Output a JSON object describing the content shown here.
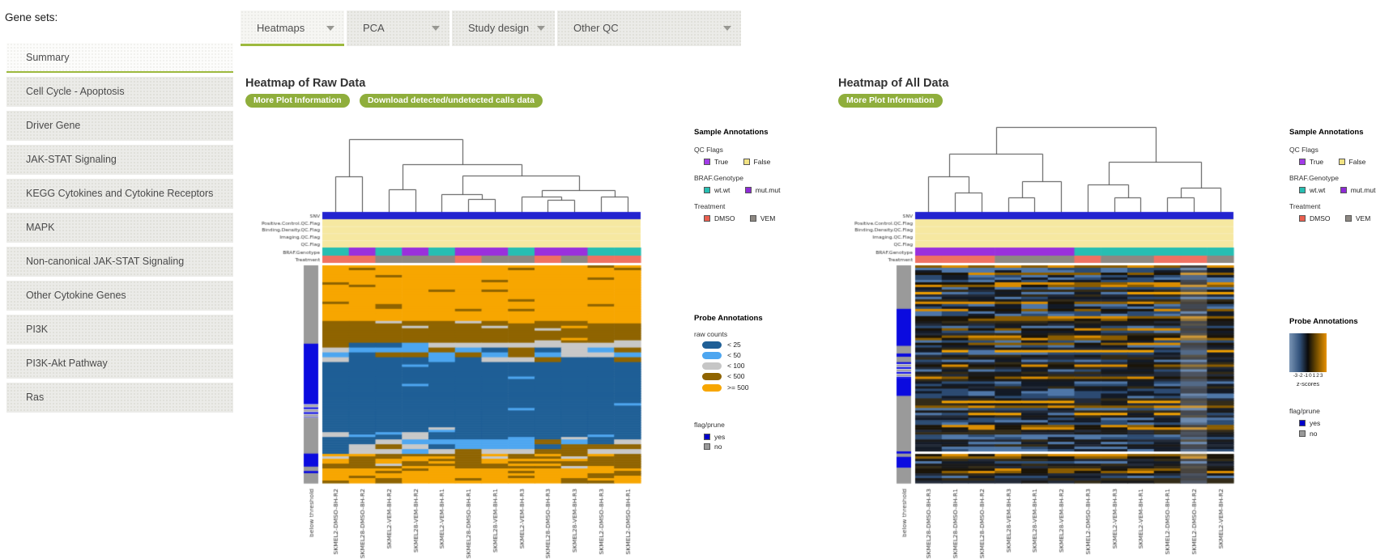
{
  "sidebar": {
    "label": "Gene sets:",
    "active_index": 0,
    "items": [
      "Summary",
      "Cell Cycle - Apoptosis",
      "Driver Gene",
      "JAK-STAT Signaling",
      "KEGG Cytokines and Cytokine Receptors",
      "MAPK",
      "Non-canonical JAK-STAT Signaling",
      "Other Cytokine Genes",
      "PI3K",
      "PI3K-Akt Pathway",
      "Ras"
    ]
  },
  "tabs": [
    "Heatmaps",
    "PCA",
    "Study design",
    "Other QC"
  ],
  "panels": {
    "raw": {
      "title": "Heatmap of Raw Data",
      "buttons": [
        "More Plot Information",
        "Download detected/undetected calls data"
      ]
    },
    "all": {
      "title": "Heatmap of All Data",
      "buttons": [
        "More Plot Information"
      ]
    }
  },
  "legend": {
    "sample_title": "Sample Annotations",
    "qc": {
      "label": "QC Flags",
      "items": [
        {
          "label": "True",
          "color": "#A23BE8"
        },
        {
          "label": "False",
          "color": "#F2E383"
        }
      ]
    },
    "braf": {
      "label": "BRAF.Genotype",
      "items": [
        {
          "label": "wt.wt",
          "color": "#27BEB2"
        },
        {
          "label": "mut.mut",
          "color": "#8E2BD6"
        }
      ]
    },
    "treatment": {
      "label": "Treatment",
      "items": [
        {
          "label": "DMSO",
          "color": "#EA5F4F"
        },
        {
          "label": "VEM",
          "color": "#8D8882"
        }
      ]
    },
    "probe_title": "Probe Annotations",
    "raw_counts": {
      "label": "raw counts",
      "items": [
        {
          "label": "< 25",
          "color": "#1F5F96"
        },
        {
          "label": "< 50",
          "color": "#4DA6F0"
        },
        {
          "label": "< 100",
          "color": "#C6C6C6"
        },
        {
          "label": "< 500",
          "color": "#8F6400"
        },
        {
          "label": ">= 500",
          "color": "#F7A600"
        }
      ]
    },
    "zscale": {
      "ticks": "-3 -2 -1 0 1 2 3",
      "label": "z-scores",
      "stops": [
        "#7A95B5 0%",
        "#31517A 28%",
        "#0A0A0A 50%",
        "#6E4A00 72%",
        "#E89200 100%"
      ]
    },
    "flag_prune": {
      "label": "flag/prune",
      "items": [
        {
          "label": "yes",
          "color": "#0000CC"
        },
        {
          "label": "no",
          "color": "#999999"
        }
      ]
    }
  },
  "colors": {
    "accent_green": "#9DB93E",
    "button_green": "#8FAE3C",
    "snv": "#2323CF",
    "qc_false": "#F6E8A1",
    "wt": "#27BEB2",
    "mut": "#9A30DC",
    "dmso": "#EF7162",
    "vem": "#8D8882",
    "side_blue": "#0B0BDF",
    "side_gray": "#9A9A9A"
  },
  "chart_data": [
    {
      "type": "heatmap",
      "panel": "raw",
      "mode": "raw",
      "title": "Heatmap of Raw Data",
      "value_encoding": "binned raw counts: < 25, < 50, < 100, < 500, >= 500",
      "columns": [
        "SKMEL2-DMSO-8H-R2",
        "SKMEL28-DMSO-8H-R2",
        "SKMEL2-VEM-8H-R2",
        "SKMEL28-VEM-8H-R2",
        "SKMEL2-VEM-8H-R1",
        "SKMEL28-DMSO-8H-R1",
        "SKMEL28-VEM-8H-R1",
        "SKMEL2-VEM-8H-R3",
        "SKMEL28-DMSO-8H-R3",
        "SKMEL28-VEM-8H-R3",
        "SKMEL2-DMSO-8H-R3",
        "SKMEL2-DMSO-8H-R1"
      ],
      "side_column_label": "below threshold",
      "row_annotation_labels": [
        "SNV",
        "Positive.Control.QC.Flag",
        "Binding.Density.QC.Flag",
        "Imaging.QC.Flag",
        "QC.Flag",
        "BRAF.Genotype",
        "Treatment"
      ],
      "snv": "solid blue across all columns",
      "qc_flags": "False (pale yellow) for all columns on all four QC flag rows",
      "braf_genotype": [
        "wt.wt",
        "mut.mut",
        "wt.wt",
        "mut.mut",
        "wt.wt",
        "mut.mut",
        "mut.mut",
        "wt.wt",
        "mut.mut",
        "mut.mut",
        "wt.wt",
        "wt.wt"
      ],
      "treatment": [
        "DMSO",
        "DMSO",
        "VEM",
        "VEM",
        "VEM",
        "DMSO",
        "VEM",
        "VEM",
        "DMSO",
        "VEM",
        "DMSO",
        "DMSO"
      ],
      "dendrogram": [
        32,
        [
          78,
          0,
          1
        ],
        [
          63,
          [
            94,
            2,
            3
          ],
          [
            77,
            [
              100,
              4,
              [
                106,
                5,
                6
              ]
            ],
            [
              95,
              [
                103,
                7,
                [
                  107,
                  8,
                  9
                ]
              ],
              [
                103,
                10,
                11
              ]
            ]
          ]
        ]
      ],
      "approx_rows": 90,
      "bands": [
        {
          "y0": 0.0,
          "y1": 0.255,
          "base": "#F7A600",
          "streaks": [
            {
              "color": "#8F6400",
              "density": 0.05
            }
          ]
        },
        {
          "y0": 0.255,
          "y1": 0.36,
          "base": "#8F6400",
          "streaks": [
            {
              "color": "#C8C8C8",
              "density": 0.05
            },
            {
              "color": "#F7A600",
              "density": 0.03
            }
          ]
        },
        {
          "y0": 0.36,
          "y1": 0.445,
          "choices": [
            "#C8C8C8",
            "#C8C8C8",
            "#4DA6F0",
            "#8F6400",
            "#1F5F96"
          ]
        },
        {
          "y0": 0.445,
          "y1": 0.74,
          "base": "#1F5F96",
          "streaks": [
            {
              "color": "#4DA6F0",
              "density": 0.02
            }
          ]
        },
        {
          "y0": 0.74,
          "y1": 0.8,
          "base": "#1F5F96",
          "streaks": [
            {
              "color": "#4DA6F0",
              "density": 0.12
            },
            {
              "color": "#C8C8C8",
              "density": 0.06
            }
          ]
        },
        {
          "y0": 0.8,
          "y1": 0.865,
          "choices": [
            "#4DA6F0",
            "#C8C8C8",
            "#C8C8C8",
            "#4DA6F0",
            "#1F5F96",
            "#8F6400"
          ]
        },
        {
          "y0": 0.865,
          "y1": 0.93,
          "base": "#8F6400",
          "streaks": [
            {
              "color": "#F7A600",
              "density": 0.22
            },
            {
              "color": "#C8C8C8",
              "density": 0.05
            }
          ]
        },
        {
          "y0": 0.93,
          "y1": 1.001,
          "base": "#F7A600",
          "streaks": [
            {
              "color": "#8F6400",
              "density": 0.2
            }
          ]
        }
      ],
      "side_segments": [
        {
          "f0": 0.0,
          "f1": 0.36,
          "c": "gray"
        },
        {
          "f0": 0.36,
          "f1": 0.63,
          "c": "blue"
        },
        {
          "f0": 0.63,
          "f1": 0.7,
          "c": "stripes"
        },
        {
          "f0": 0.7,
          "f1": 0.865,
          "c": "gray"
        },
        {
          "f0": 0.865,
          "f1": 0.925,
          "c": "blue"
        },
        {
          "f0": 0.925,
          "f1": 0.945,
          "c": "gray"
        },
        {
          "f0": 0.945,
          "f1": 0.955,
          "c": "blue"
        },
        {
          "f0": 0.955,
          "f1": 1.001,
          "c": "gray"
        }
      ]
    },
    {
      "type": "heatmap",
      "panel": "all",
      "mode": "zscore",
      "title": "Heatmap of All Data",
      "value_encoding": "z-scores, blue-black-orange gradient",
      "zlim": [
        -3,
        3
      ],
      "columns": [
        "SKMEL28-DMSO-8H-R3",
        "SKMEL28-DMSO-8H-R1",
        "SKMEL28-DMSO-8H-R2",
        "SKMEL28-VEM-8H-R3",
        "SKMEL28-VEM-8H-R1",
        "SKMEL28-VEM-8H-R2",
        "SKMEL2-DMSO-8H-R3",
        "SKMEL2-VEM-8H-R3",
        "SKMEL2-VEM-8H-R1",
        "SKMEL2-DMSO-8H-R1",
        "SKMEL2-DMSO-8H-R2",
        "SKMEL2-VEM-8H-R2"
      ],
      "side_column_label": "below threshold",
      "row_annotation_labels": [
        "SNV",
        "Positive.Control.QC.Flag",
        "Binding.Density.QC.Flag",
        "Imaging.QC.Flag",
        "QC.Flag",
        "BRAF.Genotype",
        "Treatment"
      ],
      "snv": "solid blue across all columns",
      "qc_flags": "False (pale yellow) for all columns on all four QC flag rows",
      "braf_genotype": [
        "mut.mut",
        "mut.mut",
        "mut.mut",
        "mut.mut",
        "mut.mut",
        "mut.mut",
        "wt.wt",
        "wt.wt",
        "wt.wt",
        "wt.wt",
        "wt.wt",
        "wt.wt"
      ],
      "treatment": [
        "DMSO",
        "DMSO",
        "DMSO",
        "VEM",
        "VEM",
        "VEM",
        "DMSO",
        "VEM",
        "VEM",
        "DMSO",
        "DMSO",
        "VEM"
      ],
      "dendrogram": [
        17,
        [
          50,
          [
            78,
            0,
            [
              98,
              1,
              2
            ]
          ],
          [
            84,
            [
              104,
              3,
              4
            ],
            5
          ]
        ],
        [
          60,
          [
            88,
            6,
            [
              104,
              7,
              8
            ]
          ],
          [
            92,
            [
              104,
              9,
              10
            ],
            11
          ]
        ]
      ],
      "approx_rows": 90,
      "white_row": 0.859,
      "light_cols": [
        10
      ],
      "z_palettes": {
        "orange": [
          "#D98C00",
          "#8A5C00",
          "#1A1408"
        ],
        "blue": [
          "#4F77A8",
          "#2C4B72",
          "#131A26"
        ],
        "dark": [
          "#1A1A1A",
          "#332B18",
          "#222A38"
        ],
        "bright": "#F0A000"
      },
      "side_segments": [
        {
          "f0": 0.0,
          "f1": 0.2,
          "c": "gray"
        },
        {
          "f0": 0.2,
          "f1": 0.37,
          "c": "blue"
        },
        {
          "f0": 0.37,
          "f1": 0.405,
          "c": "gray"
        },
        {
          "f0": 0.405,
          "f1": 0.42,
          "c": "blue"
        },
        {
          "f0": 0.42,
          "f1": 0.445,
          "c": "gray"
        },
        {
          "f0": 0.445,
          "f1": 0.52,
          "c": "stripes"
        },
        {
          "f0": 0.52,
          "f1": 0.6,
          "c": "blue"
        },
        {
          "f0": 0.6,
          "f1": 0.855,
          "c": "gray"
        },
        {
          "f0": 0.855,
          "f1": 0.865,
          "c": "blue"
        },
        {
          "f0": 0.865,
          "f1": 0.88,
          "c": "gray"
        },
        {
          "f0": 0.88,
          "f1": 0.93,
          "c": "blue"
        },
        {
          "f0": 0.93,
          "f1": 1.001,
          "c": "gray"
        }
      ]
    }
  ]
}
